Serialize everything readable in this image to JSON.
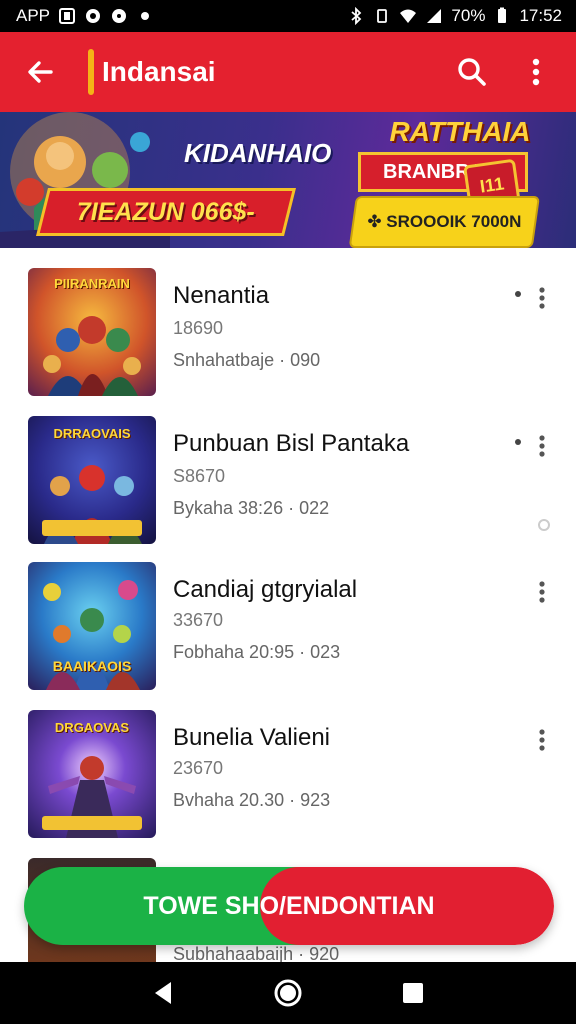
{
  "status_bar": {
    "left_label": "APP",
    "battery": "70%",
    "time": "17:52",
    "icons": [
      "notification-icon",
      "camera-icon",
      "circle-icon",
      "dot-icon",
      "bluetooth-icon",
      "vibrate-icon",
      "wifi-icon",
      "signal-icon",
      "battery-icon"
    ]
  },
  "app_bar": {
    "title": "Indansai",
    "back_icon": "arrow-left-icon",
    "search_icon": "search-icon",
    "menu_icon": "more-vertical-icon",
    "color": "#e4212f",
    "accent": "#f5b316"
  },
  "banner": {
    "headline": "KIDANHAIO",
    "ribbon_text": "7IEAZUN 066$-",
    "kicker": "RATTHAIA",
    "badge_text": "BRANBRAIS",
    "button_text": "✤ SROOOIK 7000N",
    "gem_text": "I11"
  },
  "list": {
    "items": [
      {
        "thumb_title": "PIIRANRAIN",
        "title": "Nenantia",
        "sub": "18690",
        "meta": "Snhahatbaje · 090",
        "has_dot": true,
        "has_ring": false
      },
      {
        "thumb_title": "DRRAOVAIS",
        "title": "Punbuan Bisl Pantaka",
        "sub": "S8670",
        "meta": "Bykaha 38:26 · 022",
        "has_dot": true,
        "has_ring": true
      },
      {
        "thumb_title": "BAAIKAOIS",
        "title": "Candiaj gtgryialal",
        "sub": "33670",
        "meta": "Fobhaha 20:95 · 023",
        "has_dot": false,
        "has_ring": false
      },
      {
        "thumb_title": "DRGAOVAS",
        "title": "Bunelia Valieni",
        "sub": "23670",
        "meta": "Bvhaha 20.30 · 923",
        "has_dot": false,
        "has_ring": false
      },
      {
        "thumb_title": "",
        "title": "",
        "sub": "",
        "meta": "Subhahaabaijh · 920",
        "has_dot": false,
        "has_ring": false
      }
    ]
  },
  "toggle": {
    "label": "TOWE SHO/ENDONTIAN",
    "left_color": "#1bb246",
    "right_color": "#e21f31"
  },
  "nav_bar": {
    "back_icon": "triangle-back-icon",
    "home_icon": "circle-home-icon",
    "recents_icon": "square-recents-icon"
  }
}
